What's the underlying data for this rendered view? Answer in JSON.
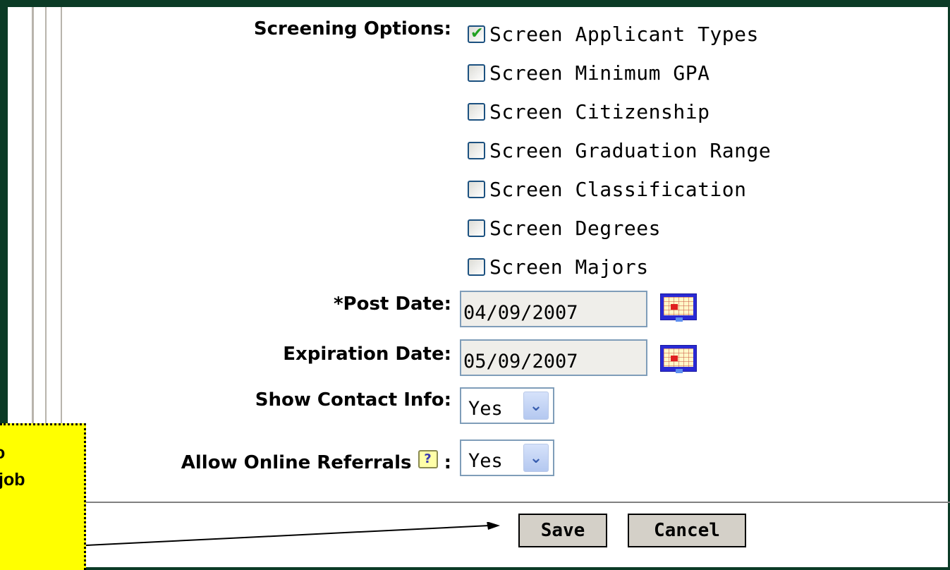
{
  "form": {
    "screening_label": "Screening Options:",
    "screening_options": [
      {
        "label": "Screen Applicant Types",
        "checked": true
      },
      {
        "label": "Screen Minimum GPA",
        "checked": false
      },
      {
        "label": "Screen Citizenship",
        "checked": false
      },
      {
        "label": "Screen Graduation Range",
        "checked": false
      },
      {
        "label": "Screen Classification",
        "checked": false
      },
      {
        "label": "Screen Degrees",
        "checked": false
      },
      {
        "label": "Screen Majors",
        "checked": false
      }
    ],
    "post_date_label": "*Post Date:",
    "post_date_value": "04/09/2007",
    "expiration_date_label": "Expiration Date:",
    "expiration_date_value": "05/09/2007",
    "show_contact_label": "Show Contact Info:",
    "show_contact_value": "Yes",
    "allow_referrals_label": "Allow Online Referrals",
    "allow_referrals_colon": ":",
    "allow_referrals_value": "Yes",
    "help_icon_glyph": "?"
  },
  "buttons": {
    "save_label": "Save",
    "cancel_label": "Cancel"
  },
  "callout": {
    "line1": "o",
    "line2": "job"
  },
  "colors": {
    "frame": "#0b3b26",
    "callout_bg": "#ffff00",
    "checkmark": "#21a121"
  },
  "icons": {
    "calendar": "calendar-icon",
    "help": "help-icon",
    "dropdown": "chevron-down-icon",
    "check": "checkmark-icon"
  }
}
